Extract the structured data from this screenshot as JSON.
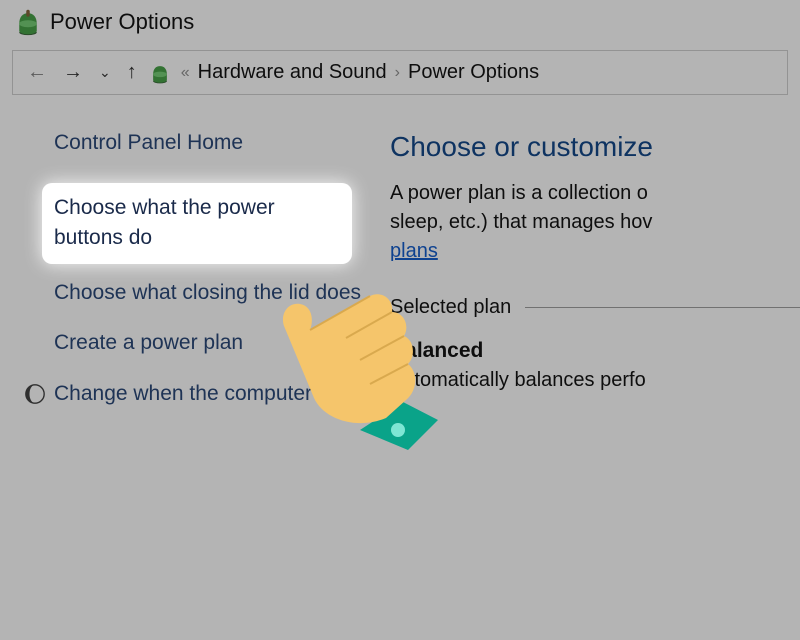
{
  "title": "Power Options",
  "breadcrumb": {
    "item1": "Hardware and Sound",
    "item2": "Power Options"
  },
  "sidebar": {
    "home": "Control Panel Home",
    "link1": "Choose what the power buttons do",
    "link2": "Choose what closing the lid does",
    "link3": "Create a power plan",
    "link4": "Change when the computer sleeps"
  },
  "main": {
    "heading": "Choose or customize",
    "desc_part1": "A power plan is a collection o",
    "desc_part2": "sleep, etc.) that manages hov",
    "plans_link": "plans",
    "section_label": "Selected plan",
    "plan_name": "Balanced",
    "plan_desc": "Automatically balances perfo"
  }
}
